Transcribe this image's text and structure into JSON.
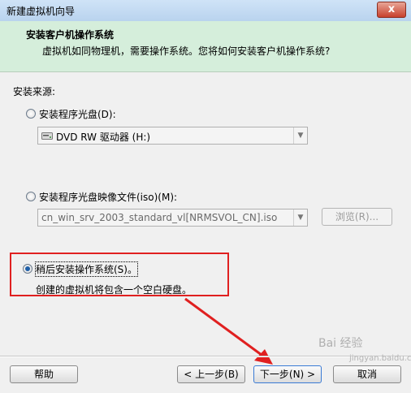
{
  "window": {
    "title": "新建虚拟机向导",
    "close_glyph": "x"
  },
  "header": {
    "title": "安装客户机操作系统",
    "subtitle": "虚拟机如同物理机，需要操作系统。您将如何安装客户机操作系统?"
  },
  "install_source": {
    "label": "安装来源:",
    "disc_option": {
      "label": "安装程序光盘(D):",
      "selected": false
    },
    "disc_combo": {
      "value": "DVD RW 驱动器 (H:)",
      "icon": "dvd-drive-icon"
    },
    "iso_option": {
      "label": "安装程序光盘映像文件(iso)(M):",
      "selected": false
    },
    "iso_combo": {
      "value": "cn_win_srv_2003_standard_vl[NRMSVOL_CN].iso"
    },
    "browse_button": "浏览(R)...",
    "later_option": {
      "label": "稍后安装操作系统(S)。",
      "selected": true
    },
    "later_description": "创建的虚拟机将包含一个空白硬盘。"
  },
  "footer": {
    "help_button": "帮助",
    "back_button": "< 上一步(B)",
    "next_button": "下一步(N) >",
    "cancel_button": "取消"
  },
  "annotation": {
    "highlight_color": "#e02020"
  },
  "watermark": {
    "text": "Bai 经验",
    "sub": "jingyan.baidu.com"
  }
}
